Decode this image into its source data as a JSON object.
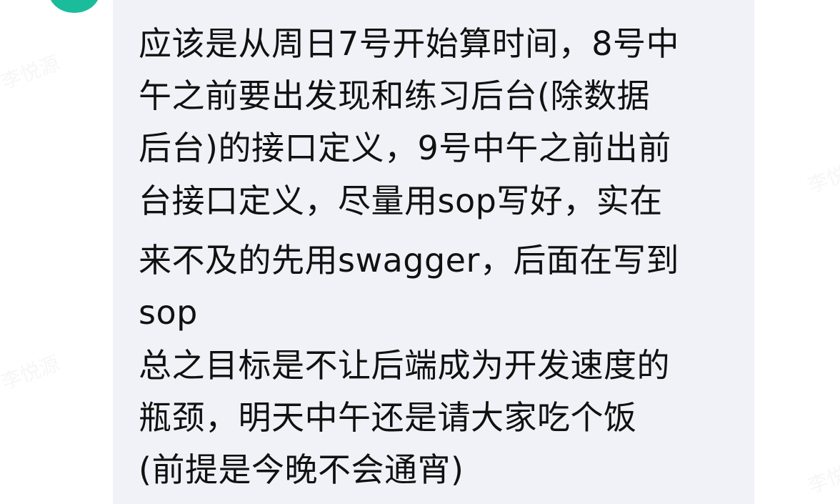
{
  "chat": {
    "avatar_icon": "user-avatar",
    "accent_color": "#1abc9c",
    "bubble_color": "#f1f2f7",
    "message_lines": [
      "应该是从周日7号开始算时间，8号中",
      "午之前要出发现和练习后台(除数据",
      "后台)的接口定义，9号中午之前出前",
      "台接口定义，尽量用sop写好，实在",
      "来不及的先用swagger，后面在写到",
      "sop",
      "总之目标是不让后端成为开发速度的",
      "瓶颈，明天中午还是请大家吃个饭",
      "(前提是今晚不会通宵)"
    ]
  }
}
